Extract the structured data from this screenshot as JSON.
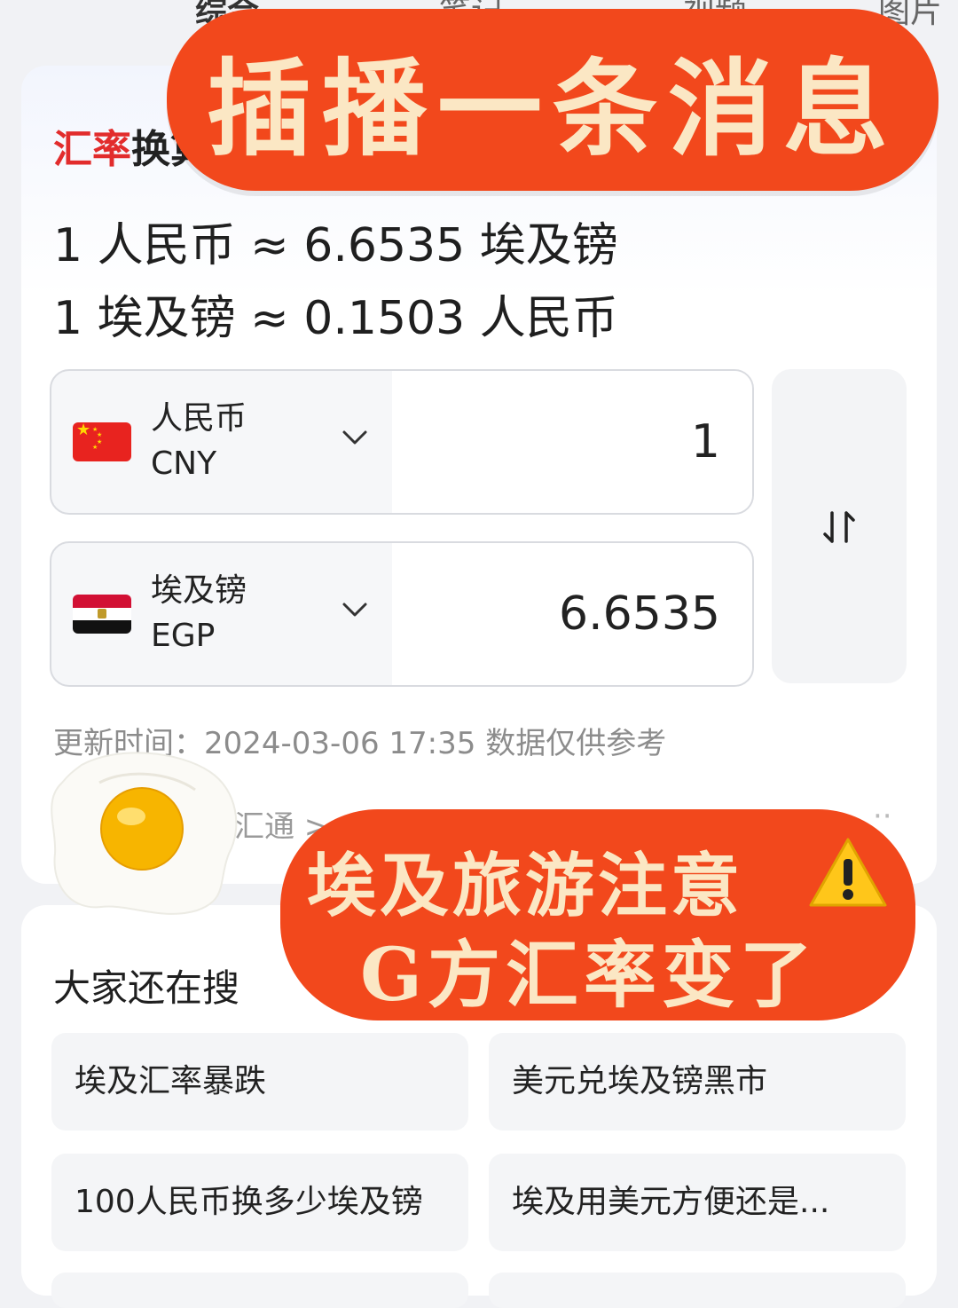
{
  "top_tabs": [
    "综合",
    "笔记",
    "视频",
    "图片"
  ],
  "banner_top": {
    "text": "插播一条消息"
  },
  "card": {
    "title_red": "汇率",
    "title_black": "换算",
    "rate_line1": "1 人民币 ≈ 6.6535 埃及镑",
    "rate_line2": "1 埃及镑 ≈ 0.1503 人民币",
    "from": {
      "name": "人民币",
      "code": "CNY",
      "amount": "1",
      "flag": "china-flag-icon"
    },
    "to": {
      "name": "埃及镑",
      "code": "EGP",
      "amount": "6.6535",
      "flag": "egypt-flag-icon"
    },
    "swap_icon": "swap-arrows-icon",
    "update_text": "更新时间：2024-03-06 17:35 数据仅供参考",
    "more_link": "汇通 >",
    "more_dots": "··"
  },
  "banner_bottom": {
    "line1": "埃及旅游注意",
    "warning_icon": "warning-icon",
    "line2": "G方汇率变了"
  },
  "sticker": "fried-egg-sticker",
  "related": {
    "title": "大家还在搜",
    "more": "···",
    "chips": [
      "埃及汇率暴跌",
      "美元兑埃及镑黑市",
      "100人民币换多少埃及镑",
      "埃及用美元方便还是..."
    ]
  },
  "colors": {
    "accent_red": "#e22c2c",
    "banner_orange": "#f2481c",
    "banner_text": "#fbe7c4"
  }
}
